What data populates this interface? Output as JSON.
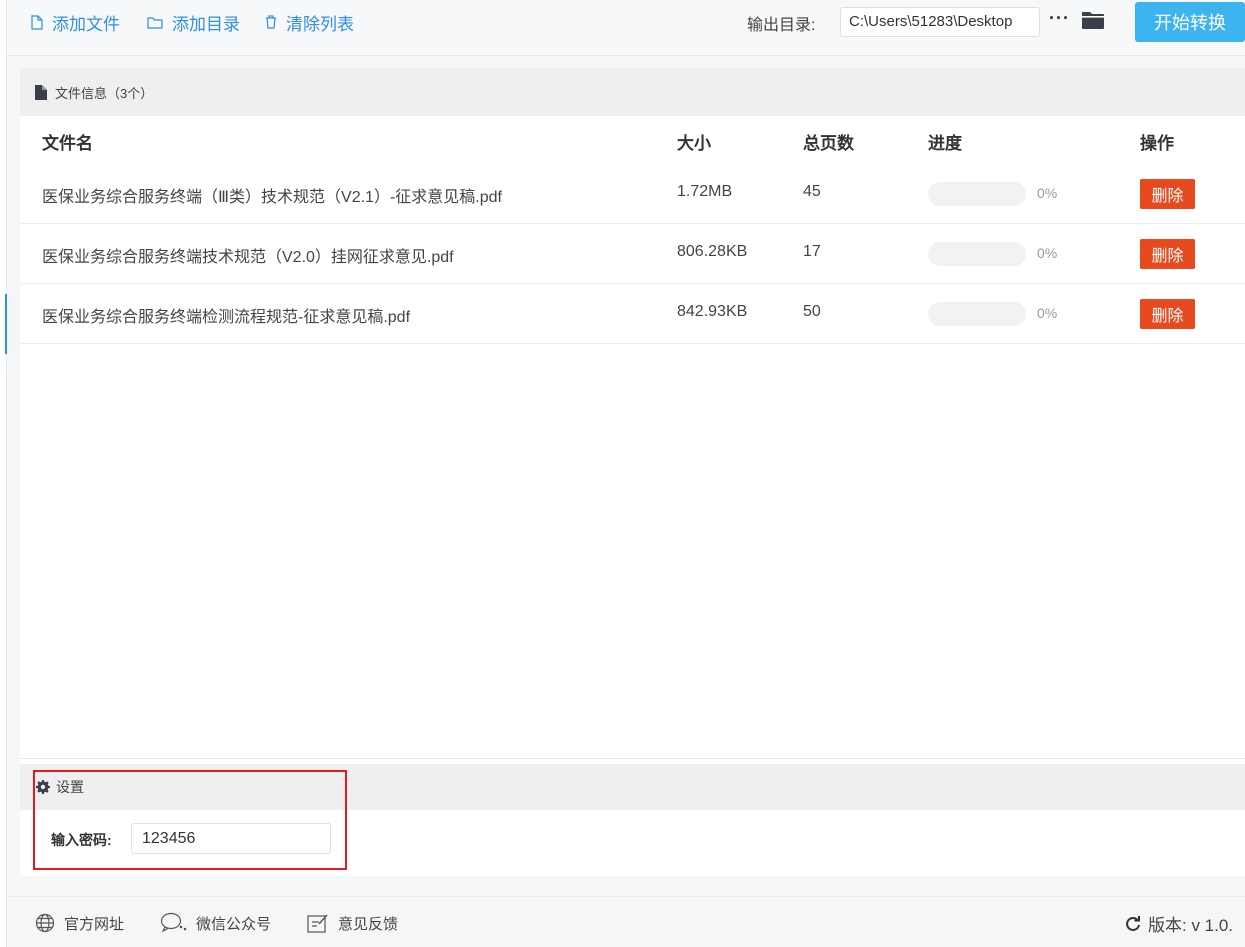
{
  "toolbar": {
    "add_file": "添加文件",
    "add_dir": "添加目录",
    "clear_list": "清除列表",
    "output_label": "输出目录:",
    "output_path": "C:\\Users\\51283\\Desktop",
    "more": "···",
    "start": "开始转换"
  },
  "file_panel": {
    "title": "文件信息（3个）",
    "columns": {
      "name": "文件名",
      "size": "大小",
      "pages": "总页数",
      "progress": "进度",
      "action": "操作"
    },
    "rows": [
      {
        "name": "医保业务综合服务终端（Ⅲ类）技术规范（V2.1）-征求意见稿.pdf",
        "size": "1.72MB",
        "pages": "45",
        "progress_text": "0%",
        "progress": 0,
        "action": "删除"
      },
      {
        "name": "医保业务综合服务终端技术规范（V2.0）挂网征求意见.pdf",
        "size": "806.28KB",
        "pages": "17",
        "progress_text": "0%",
        "progress": 0,
        "action": "删除"
      },
      {
        "name": "医保业务综合服务终端检测流程规范-征求意见稿.pdf",
        "size": "842.93KB",
        "pages": "50",
        "progress_text": "0%",
        "progress": 0,
        "action": "删除"
      }
    ]
  },
  "settings": {
    "title": "设置",
    "password_label": "输入密码:",
    "password_value": "123456"
  },
  "footer": {
    "website": "官方网址",
    "wechat": "微信公众号",
    "feedback": "意见反馈",
    "version": "版本: v 1.0."
  },
  "colors": {
    "accent": "#2f8fe8",
    "start_button": "#3cb4f0",
    "delete_button": "#e64a1e",
    "highlight_box": "#e6191e"
  }
}
